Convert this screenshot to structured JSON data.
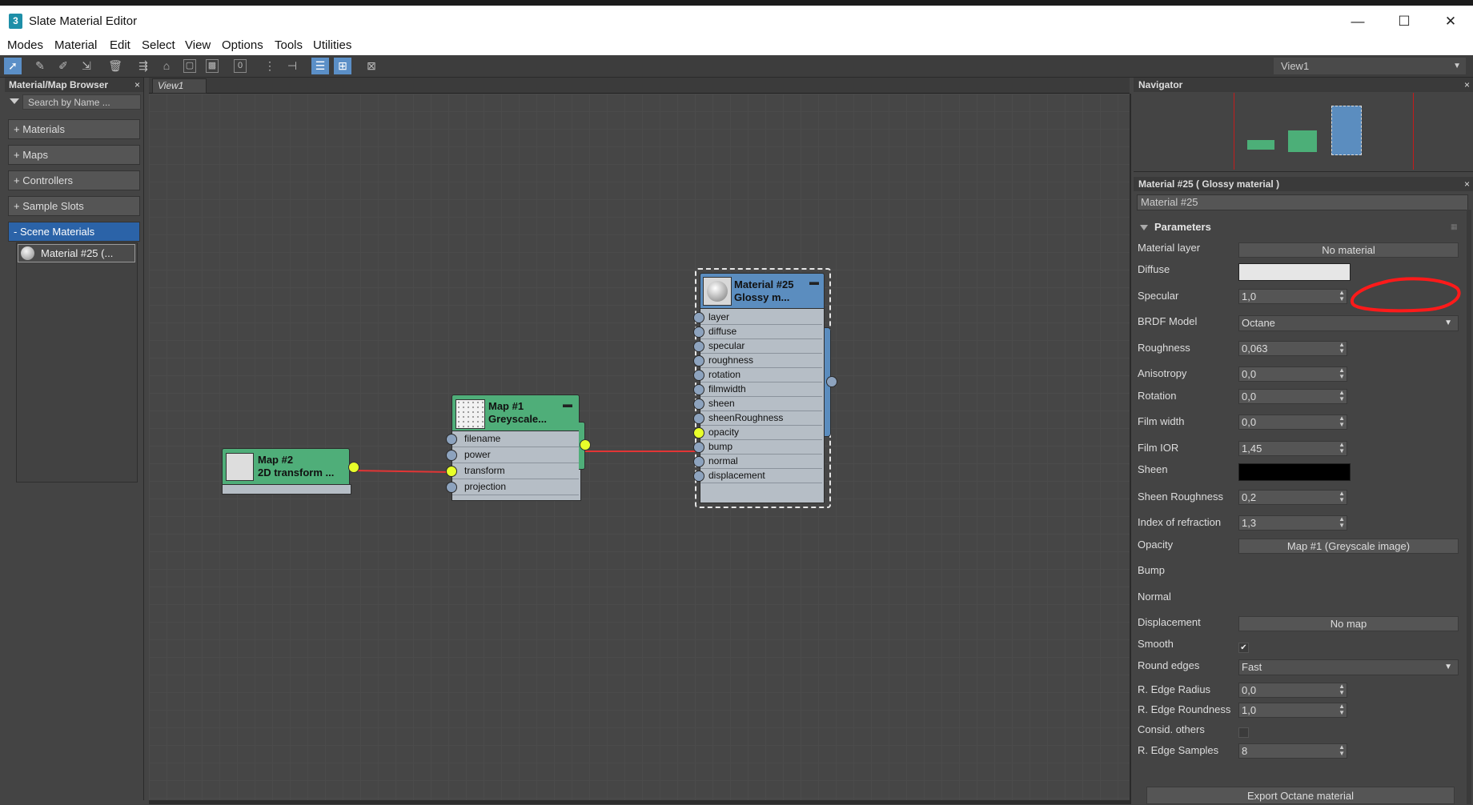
{
  "window": {
    "title": "Slate Material Editor",
    "icon_glyph": "3",
    "minimize": "—",
    "maximize": "☐",
    "close": "✕"
  },
  "menu": [
    "Modes",
    "Material",
    "Edit",
    "Select",
    "View",
    "Options",
    "Tools",
    "Utilities"
  ],
  "toolbar": {
    "view_select": "View1",
    "icons": [
      "select-arrow-icon",
      "eyedropper-icon",
      "pick-material-icon",
      "put-material-icon",
      "delete-icon",
      "move-children-icon",
      "hide-unused-slots-icon",
      "show-material-icon",
      "show-background-icon",
      "id-channel-icon",
      "layout-all-icon",
      "layout-children-icon",
      "show-in-viewport-icon",
      "show-end-result-icon",
      "background-pattern-icon"
    ]
  },
  "browser": {
    "title": "Material/Map Browser",
    "search_placeholder": "Search by Name ...",
    "rollouts": [
      "+ Materials",
      "+ Maps",
      "+ Controllers",
      "+ Sample Slots",
      "- Scene Materials"
    ],
    "scene_items": [
      "Material #25  (..."
    ]
  },
  "view": {
    "tab": "View1"
  },
  "nodes": {
    "map2": {
      "title1": "Map #2",
      "title2": "2D  transform ..."
    },
    "map1": {
      "title1": "Map #1",
      "title2": "Greyscale...",
      "slots": [
        "filename",
        "power",
        "transform",
        "projection"
      ]
    },
    "mat25": {
      "title1": "Material #25",
      "title2": "Glossy  m...",
      "slots": [
        "layer",
        "diffuse",
        "specular",
        "roughness",
        "rotation",
        "filmwidth",
        "sheen",
        "sheenRoughness",
        "opacity",
        "bump",
        "normal",
        "displacement"
      ]
    }
  },
  "navigator": {
    "title": "Navigator"
  },
  "material_panel": {
    "title": "Material #25  ( Glossy material )",
    "name_field": "Material #25",
    "params_header": "Parameters",
    "rows": {
      "material_layer": {
        "label": "Material layer",
        "value": "No material"
      },
      "diffuse": {
        "label": "Diffuse",
        "color": "#e6e6e6"
      },
      "specular": {
        "label": "Specular",
        "value": "1,0"
      },
      "brdf": {
        "label": "BRDF Model",
        "value": "Octane"
      },
      "roughness": {
        "label": "Roughness",
        "value": "0,063"
      },
      "anisotropy": {
        "label": "Anisotropy",
        "value": "0,0"
      },
      "rotation": {
        "label": "Rotation",
        "value": "0,0"
      },
      "film_width": {
        "label": "Film width",
        "value": "0,0"
      },
      "film_ior": {
        "label": "Film IOR",
        "value": "1,45"
      },
      "sheen": {
        "label": "Sheen",
        "color": "#000000"
      },
      "sheen_roughness": {
        "label": "Sheen Roughness",
        "value": "0,2"
      },
      "ior": {
        "label": "Index of refraction",
        "value": "1,3"
      },
      "opacity": {
        "label": "Opacity",
        "value": "Map #1 (Greyscale image)"
      },
      "bump": {
        "label": "Bump"
      },
      "normal": {
        "label": "Normal"
      },
      "displacement": {
        "label": "Displacement",
        "value": "No map"
      },
      "smooth": {
        "label": "Smooth",
        "checked": "✔"
      },
      "round_edges": {
        "label": "Round edges",
        "value": "Fast"
      },
      "edge_radius": {
        "label": "R. Edge Radius",
        "value": "0,0"
      },
      "edge_roundness": {
        "label": "R. Edge Roundness",
        "value": "1,0"
      },
      "consid_others": {
        "label": "Consid. others"
      },
      "edge_samples": {
        "label": "R. Edge Samples",
        "value": "8"
      }
    },
    "export_button": "Export Octane material"
  },
  "colors": {
    "accent_selection": "#2b63a8",
    "material_node_head": "#5b8dbf",
    "map_node_head": "#4caf78",
    "wire": "#e23535",
    "annotation": "#ff1a1a"
  }
}
